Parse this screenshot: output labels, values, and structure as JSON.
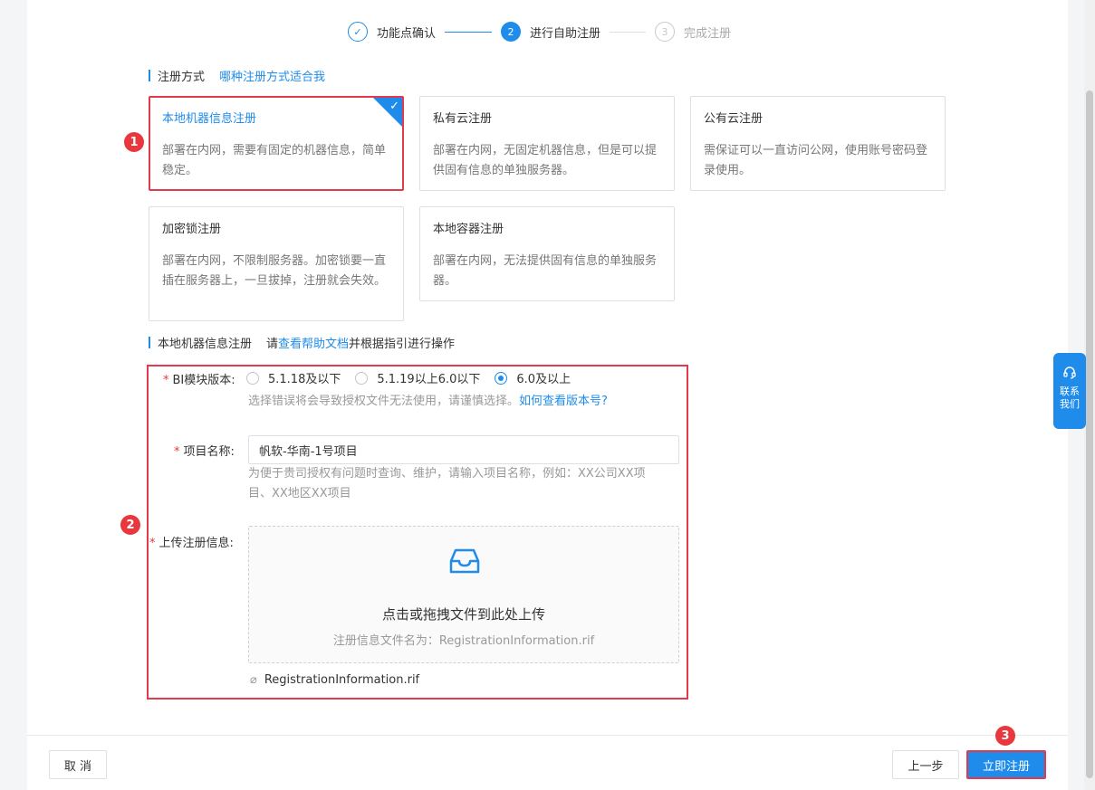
{
  "steps": [
    {
      "index": "✓",
      "label": "功能点确认",
      "state": "done"
    },
    {
      "index": "2",
      "label": "进行自助注册",
      "state": "active"
    },
    {
      "index": "3",
      "label": "完成注册",
      "state": "todo"
    }
  ],
  "registration_method": {
    "title": "注册方式",
    "help_link": "哪种注册方式适合我",
    "cards": [
      {
        "title": "本地机器信息注册",
        "desc": "部署在内网，需要有固定的机器信息，简单稳定。",
        "selected": true
      },
      {
        "title": "私有云注册",
        "desc": "部署在内网，无固定机器信息，但是可以提供固有信息的单独服务器。",
        "selected": false
      },
      {
        "title": "公有云注册",
        "desc": "需保证可以一直访问公网，使用账号密码登录使用。",
        "selected": false
      },
      {
        "title": "加密锁注册",
        "desc": "部署在内网，不限制服务器。加密锁要一直插在服务器上，一旦拔掉，注册就会失效。",
        "selected": false
      },
      {
        "title": "本地容器注册",
        "desc": "部署在内网，无法提供固有信息的单独服务器。",
        "selected": false
      }
    ]
  },
  "local_section": {
    "title": "本地机器信息注册",
    "prefix": "请",
    "doc_link": "查看帮助文档",
    "suffix": "并根据指引进行操作"
  },
  "form": {
    "version": {
      "label": "BI模块版本:",
      "options": [
        "5.1.18及以下",
        "5.1.19以上6.0以下",
        "6.0及以上"
      ],
      "selected_index": 2,
      "hint": "选择错误将会导致授权文件无法使用，请谨慎选择。",
      "hint_link": "如何查看版本号?"
    },
    "project": {
      "label": "项目名称:",
      "value": "帆软-华南-1号项目",
      "hint_line1": "为便于贵司授权有问题时查询、维护，请输入项目名称，例如：XX公司XX项",
      "hint_line2": "目、XX地区XX项目"
    },
    "upload": {
      "label": "上传注册信息:",
      "text": "点击或拖拽文件到此处上传",
      "sub": "注册信息文件名为：RegistrationInformation.rif",
      "file": "RegistrationInformation.rif"
    }
  },
  "badges": [
    "1",
    "2",
    "3"
  ],
  "footer": {
    "cancel": "取 消",
    "prev": "上一步",
    "submit": "立即注册"
  },
  "contact": {
    "label": "联系我们"
  },
  "colors": {
    "primary": "#1f8ceb",
    "highlight": "#e2394c"
  }
}
